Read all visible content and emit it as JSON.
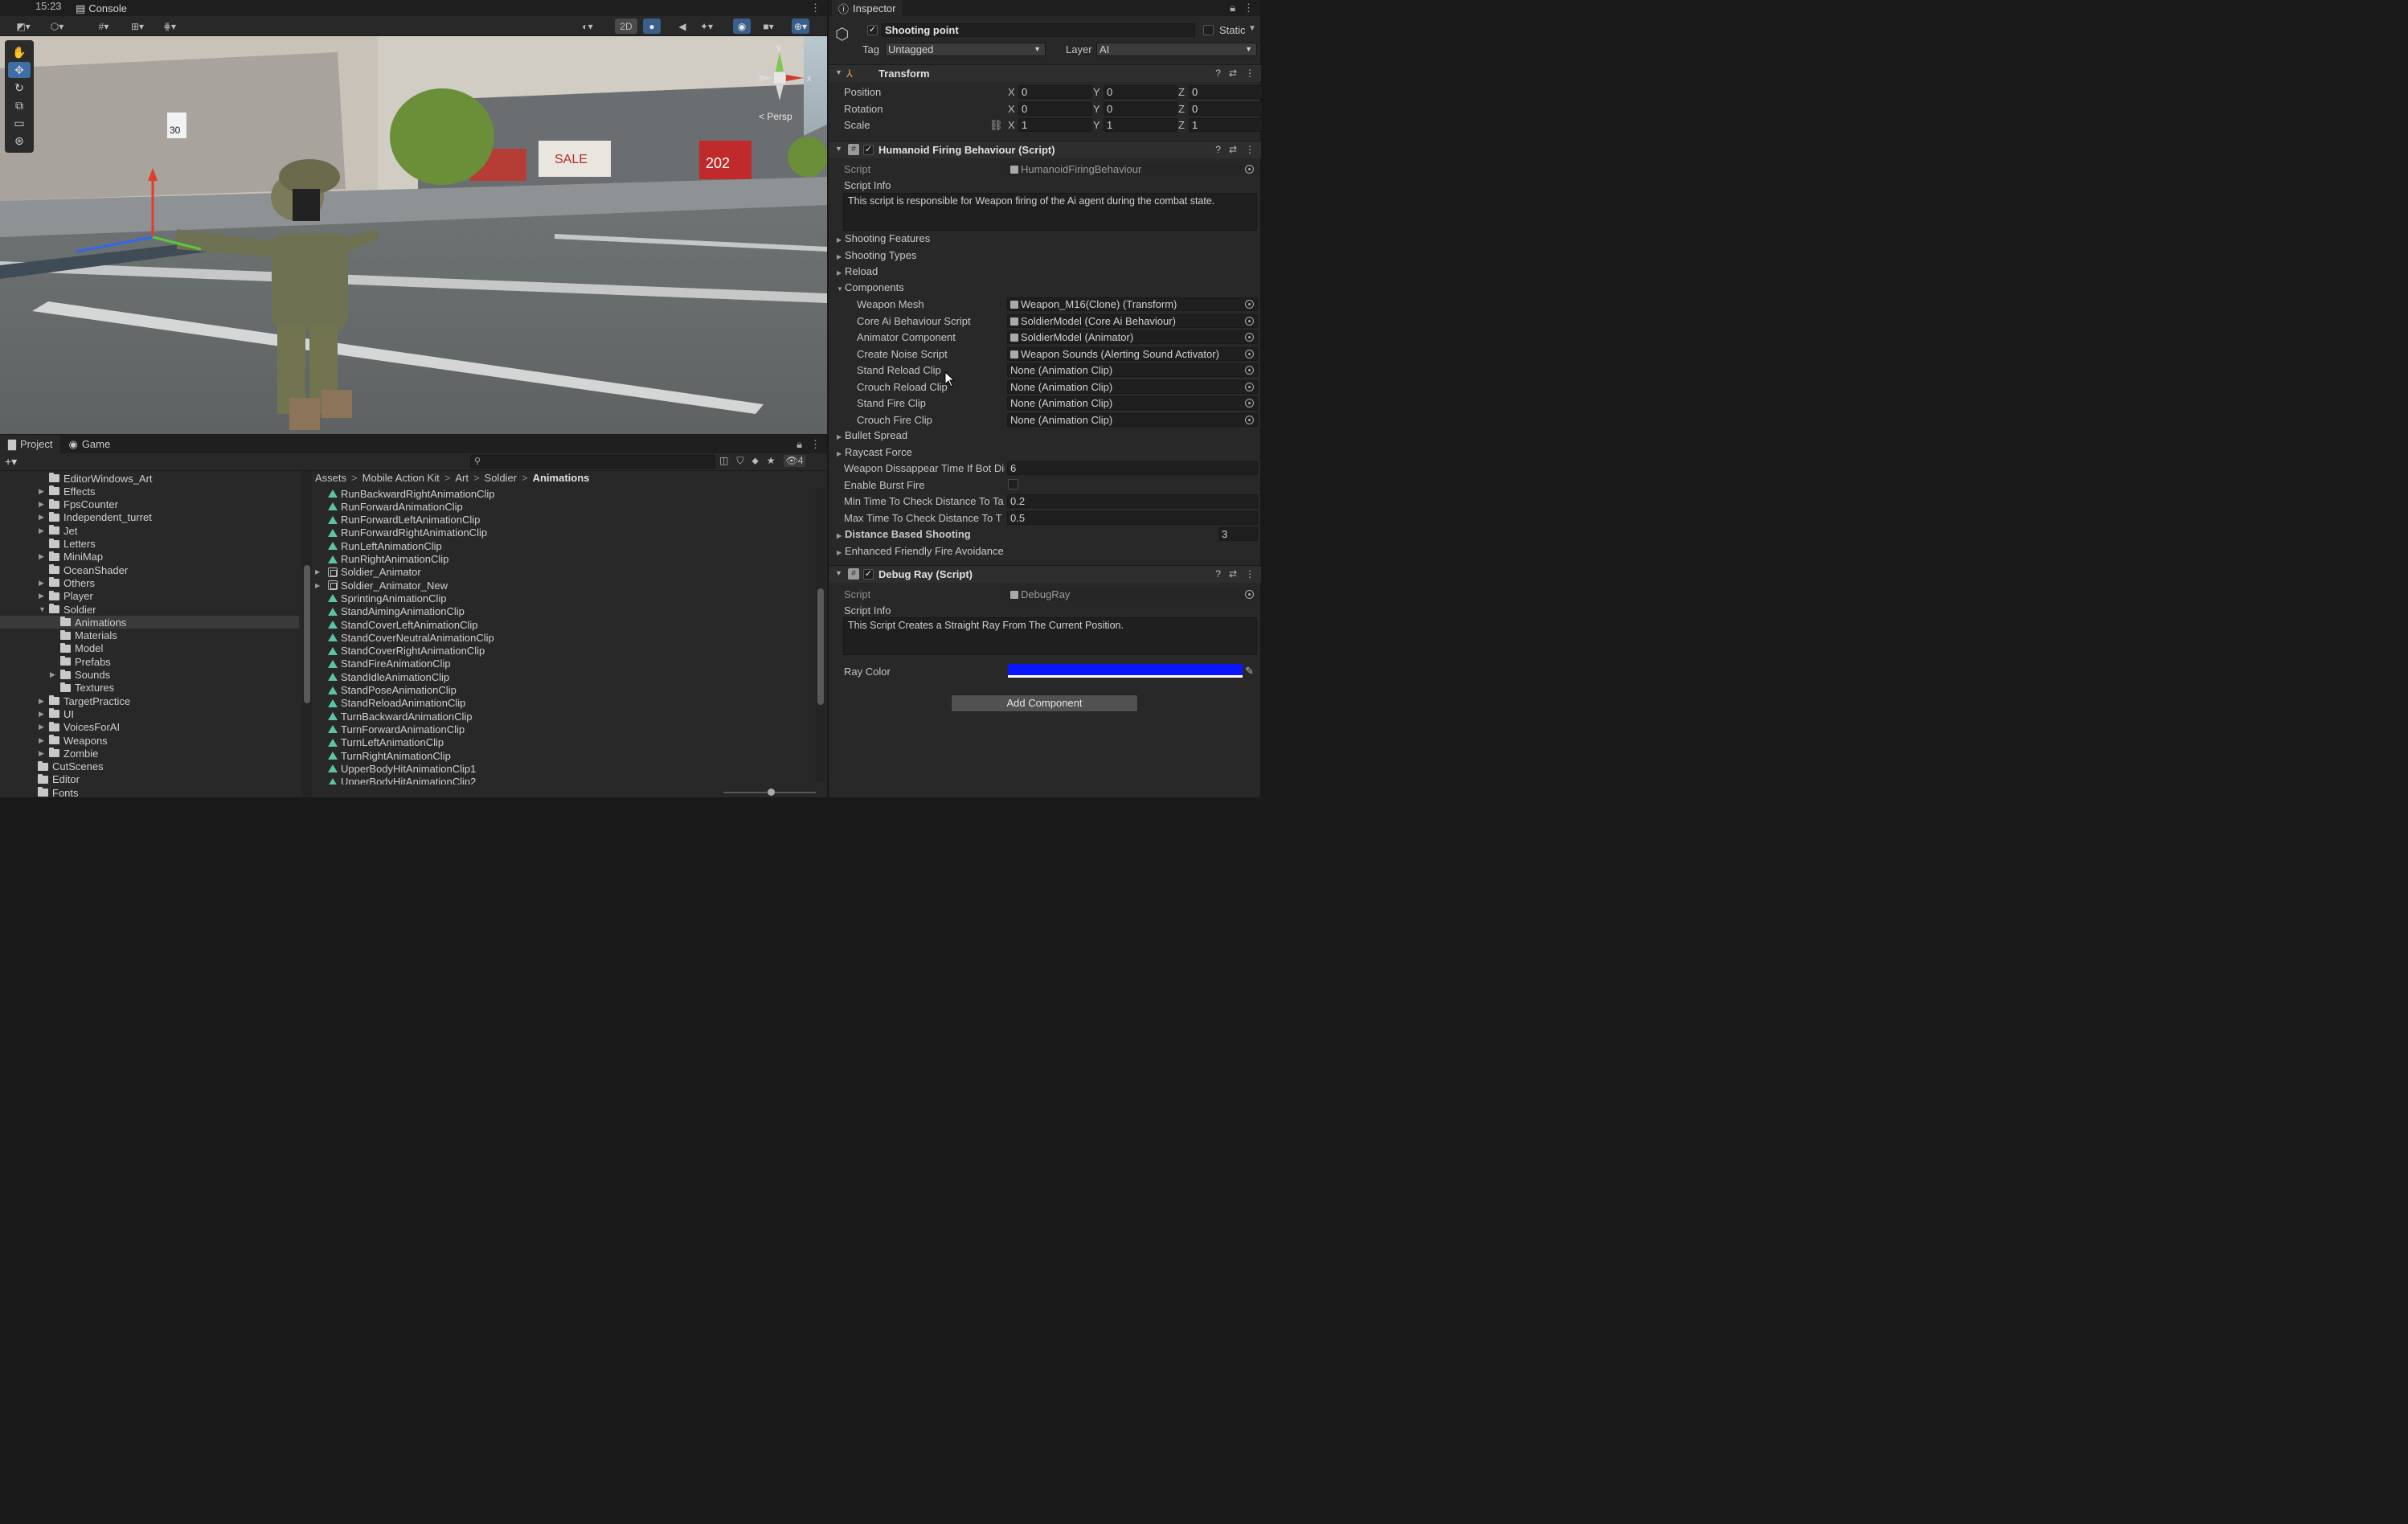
{
  "topbar": {
    "time": "15:23",
    "console_tab": "Console"
  },
  "scene": {
    "toolbar": {
      "mode_2d": "2D"
    },
    "persp_label": "< Persp",
    "gizmo_y": "y",
    "gizmo_x": "x",
    "signs": {
      "speed": "30",
      "shop": "SALE",
      "price": "202"
    }
  },
  "project": {
    "tabs": [
      "Project",
      "Game"
    ],
    "filter_count": "4",
    "tree": [
      {
        "label": "EditorWindows_Art",
        "indent": 1,
        "arrow": false
      },
      {
        "label": "Effects",
        "indent": 1,
        "arrow": true
      },
      {
        "label": "FpsCounter",
        "indent": 1,
        "arrow": true
      },
      {
        "label": "Independent_turret",
        "indent": 1,
        "arrow": true
      },
      {
        "label": "Jet",
        "indent": 1,
        "arrow": true
      },
      {
        "label": "Letters",
        "indent": 1,
        "arrow": false
      },
      {
        "label": "MiniMap",
        "indent": 1,
        "arrow": true
      },
      {
        "label": "OceanShader",
        "indent": 1,
        "arrow": false
      },
      {
        "label": "Others",
        "indent": 1,
        "arrow": true
      },
      {
        "label": "Player",
        "indent": 1,
        "arrow": true
      },
      {
        "label": "Soldier",
        "indent": 1,
        "arrow": "open"
      },
      {
        "label": "Animations",
        "indent": 2,
        "arrow": false,
        "selected": true
      },
      {
        "label": "Materials",
        "indent": 2,
        "arrow": false
      },
      {
        "label": "Model",
        "indent": 2,
        "arrow": false
      },
      {
        "label": "Prefabs",
        "indent": 2,
        "arrow": false
      },
      {
        "label": "Sounds",
        "indent": 2,
        "arrow": true
      },
      {
        "label": "Textures",
        "indent": 2,
        "arrow": false
      },
      {
        "label": "TargetPractice",
        "indent": 1,
        "arrow": true
      },
      {
        "label": "UI",
        "indent": 1,
        "arrow": true
      },
      {
        "label": "VoicesForAI",
        "indent": 1,
        "arrow": true
      },
      {
        "label": "Weapons",
        "indent": 1,
        "arrow": true
      },
      {
        "label": "Zombie",
        "indent": 1,
        "arrow": true
      },
      {
        "label": "CutScenes",
        "indent": 0,
        "arrow": false
      },
      {
        "label": "Editor",
        "indent": 0,
        "arrow": false
      },
      {
        "label": "Fonts",
        "indent": 0,
        "arrow": false
      }
    ],
    "breadcrumb": [
      "Assets",
      "Mobile Action Kit",
      "Art",
      "Soldier",
      "Animations"
    ],
    "assets": [
      {
        "name": "RunBackwardRightAnimationClip",
        "kind": "anim"
      },
      {
        "name": "RunForwardAnimationClip",
        "kind": "anim"
      },
      {
        "name": "RunForwardLeftAnimationClip",
        "kind": "anim"
      },
      {
        "name": "RunForwardRightAnimationClip",
        "kind": "anim"
      },
      {
        "name": "RunLeftAnimationClip",
        "kind": "anim"
      },
      {
        "name": "RunRightAnimationClip",
        "kind": "anim"
      },
      {
        "name": "Soldier_Animator",
        "kind": "controller"
      },
      {
        "name": "Soldier_Animator_New",
        "kind": "controller"
      },
      {
        "name": "SprintingAnimationClip",
        "kind": "anim"
      },
      {
        "name": "StandAimingAnimationClip",
        "kind": "anim"
      },
      {
        "name": "StandCoverLeftAnimationClip",
        "kind": "anim"
      },
      {
        "name": "StandCoverNeutralAnimationClip",
        "kind": "anim"
      },
      {
        "name": "StandCoverRightAnimationClip",
        "kind": "anim"
      },
      {
        "name": "StandFireAnimationClip",
        "kind": "anim"
      },
      {
        "name": "StandIdleAnimationClip",
        "kind": "anim"
      },
      {
        "name": "StandPoseAnimationClip",
        "kind": "anim"
      },
      {
        "name": "StandReloadAnimationClip",
        "kind": "anim"
      },
      {
        "name": "TurnBackwardAnimationClip",
        "kind": "anim"
      },
      {
        "name": "TurnForwardAnimationClip",
        "kind": "anim"
      },
      {
        "name": "TurnLeftAnimationClip",
        "kind": "anim"
      },
      {
        "name": "TurnRightAnimationClip",
        "kind": "anim"
      },
      {
        "name": "UpperBodyHitAnimationClip1",
        "kind": "anim"
      },
      {
        "name": "UpperBodyHitAnimationClip2",
        "kind": "anim"
      }
    ]
  },
  "inspector": {
    "tab": "Inspector",
    "object_name": "Shooting point",
    "static_label": "Static",
    "tag_label": "Tag",
    "tag_value": "Untagged",
    "layer_label": "Layer",
    "layer_value": "AI",
    "transform": {
      "title": "Transform",
      "position_label": "Position",
      "rotation_label": "Rotation",
      "scale_label": "Scale",
      "position": [
        "0",
        "0",
        "0"
      ],
      "rotation": [
        "0",
        "0",
        "0"
      ],
      "scale": [
        "1",
        "1",
        "1"
      ]
    },
    "firing": {
      "title": "Humanoid Firing Behaviour (Script)",
      "script_label": "Script",
      "script_value": "HumanoidFiringBehaviour",
      "info_label": "Script Info",
      "info_text": "This script is responsible for Weapon firing of the Ai agent during the combat state.",
      "foldouts": [
        "Shooting Features",
        "Shooting Types",
        "Reload"
      ],
      "components_label": "Components",
      "components": [
        {
          "label": "Weapon Mesh",
          "value": "Weapon_M16(Clone) (Transform)"
        },
        {
          "label": "Core Ai Behaviour Script",
          "value": "SoldierModel (Core Ai Behaviour)"
        },
        {
          "label": "Animator Component",
          "value": "SoldierModel (Animator)"
        },
        {
          "label": "Create Noise Script",
          "value": "Weapon Sounds (Alerting Sound Activator)"
        },
        {
          "label": "Stand Reload Clip",
          "value": "None (Animation Clip)"
        },
        {
          "label": "Crouch Reload Clip",
          "value": "None (Animation Clip)"
        },
        {
          "label": "Stand Fire Clip",
          "value": "None (Animation Clip)"
        },
        {
          "label": "Crouch Fire Clip",
          "value": "None (Animation Clip)"
        }
      ],
      "bullet_spread": "Bullet Spread",
      "raycast_force": "Raycast Force",
      "disappear_label": "Weapon Dissappear Time If Bot Die",
      "disappear_value": "6",
      "burst_label": "Enable Burst Fire",
      "min_label": "Min Time To Check Distance To Ta",
      "min_value": "0.2",
      "max_label": "Max Time To Check Distance To T",
      "max_value": "0.5",
      "distance_label": "Distance Based Shooting",
      "distance_value": "3",
      "friendly_label": "Enhanced Friendly Fire Avoidance"
    },
    "debug": {
      "title": "Debug Ray (Script)",
      "script_label": "Script",
      "script_value": "DebugRay",
      "info_label": "Script Info",
      "info_text": "This Script Creates a Straight Ray From The Current Position.",
      "color_label": "Ray Color",
      "color_value": "#0a14ff"
    },
    "add_component": "Add Component"
  }
}
